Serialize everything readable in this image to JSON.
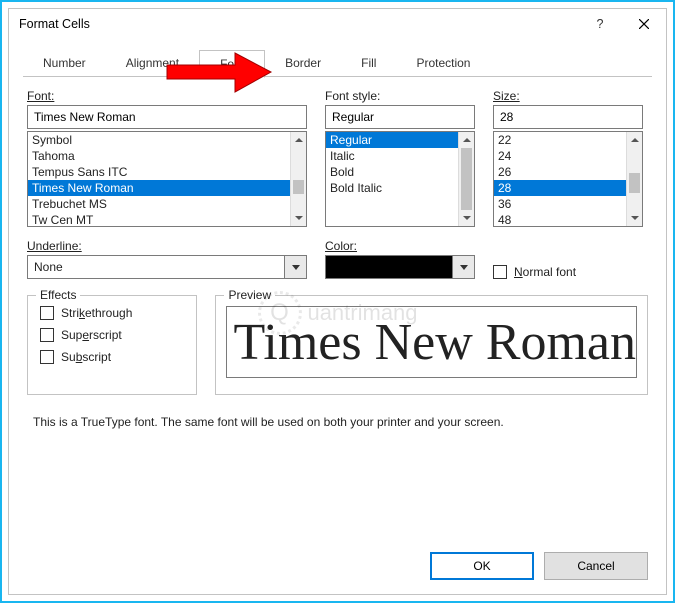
{
  "title": "Format Cells",
  "tabs": {
    "number": "Number",
    "alignment": "Alignment",
    "font": "Font",
    "border": "Border",
    "fill": "Fill",
    "protection": "Protection"
  },
  "labels": {
    "font": "Font:",
    "fontStyle": "Font style:",
    "size": "Size:",
    "underline": "Underline:",
    "color": "Color:",
    "normalFont": "Normal font",
    "effects": "Effects",
    "strikethrough": "Strikethrough",
    "superscript": "Superscript",
    "subscript": "Subscript",
    "preview": "Preview"
  },
  "font": {
    "value": "Times New Roman",
    "list": [
      "Symbol",
      "Tahoma",
      "Tempus Sans ITC",
      "Times New Roman",
      "Trebuchet MS",
      "Tw Cen MT"
    ],
    "selectedIndex": 3
  },
  "fontStyle": {
    "value": "Regular",
    "list": [
      "Regular",
      "Italic",
      "Bold",
      "Bold Italic"
    ],
    "selectedIndex": 0
  },
  "size": {
    "value": "28",
    "list": [
      "22",
      "24",
      "26",
      "28",
      "36",
      "48"
    ],
    "selectedIndex": 3
  },
  "underline": {
    "value": "None"
  },
  "color": {
    "value": "#000000"
  },
  "previewText": "Times New Roman",
  "footnote": "This is a TrueType font.  The same font will be used on both your printer and your screen.",
  "buttons": {
    "ok": "OK",
    "cancel": "Cancel"
  },
  "watermark": "uantrimang"
}
